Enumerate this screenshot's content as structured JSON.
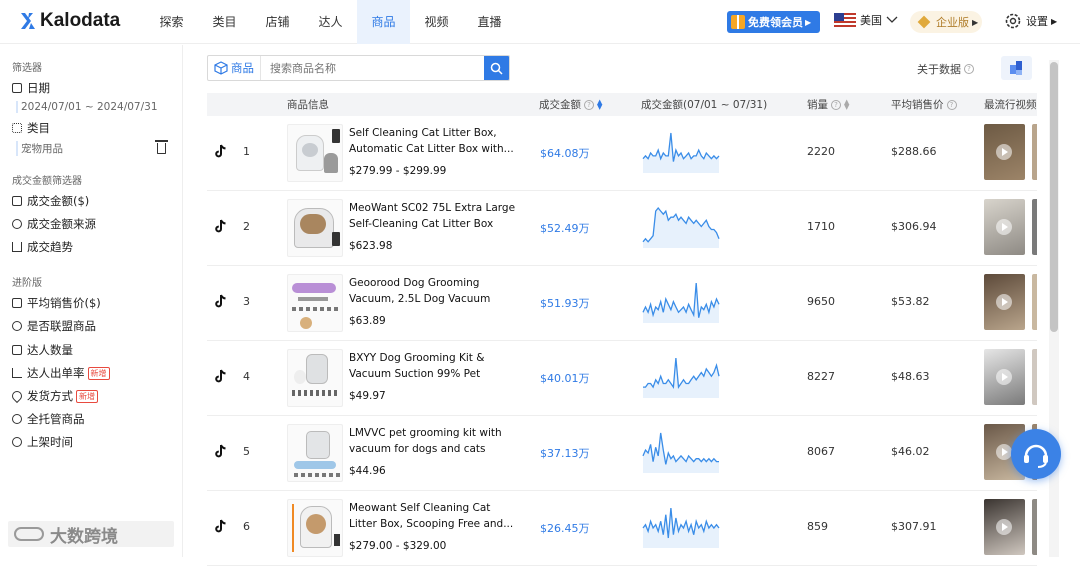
{
  "app": {
    "name": "Kalodata"
  },
  "nav": [
    "探索",
    "类目",
    "店铺",
    "达人",
    "商品",
    "视频",
    "直播"
  ],
  "nav_active_index": 4,
  "header": {
    "promo_label": "免费领会员",
    "region_label": "美国",
    "enterprise_label": "企业版",
    "settings_label": "设置"
  },
  "sidebar": {
    "filter_heading": "筛选器",
    "date_label": "日期",
    "date_value": "2024/07/01 ~ 2024/07/31",
    "category_label": "类目",
    "category_value": "宠物用品",
    "gmv_heading": "成交金额筛选器",
    "gmv_items": [
      "成交金额($)",
      "成交金额来源",
      "成交趋势"
    ],
    "advanced_heading": "进阶版",
    "advanced_items": [
      {
        "label": "平均销售价($)",
        "badge": ""
      },
      {
        "label": "是否联盟商品",
        "badge": ""
      },
      {
        "label": "达人数量",
        "badge": ""
      },
      {
        "label": "达人出单率",
        "badge": "新增"
      },
      {
        "label": "发货方式",
        "badge": "新增"
      },
      {
        "label": "全托管商品",
        "badge": ""
      },
      {
        "label": "上架时间",
        "badge": ""
      }
    ],
    "watermark": "大数跨境"
  },
  "search": {
    "tag_label": "商品",
    "placeholder": "搜索商品名称"
  },
  "about_data_label": "关于数据",
  "table": {
    "columns": [
      "商品信息",
      "成交金额",
      "成交金额(07/01 ~ 07/31)",
      "销量",
      "平均销售价",
      "最流行视频"
    ],
    "rows": [
      {
        "rank": "1",
        "title": "Self Cleaning Cat Litter Box, Automatic Cat Litter Box with...",
        "price": "$279.99 - $299.99",
        "gmv": "$64.08万",
        "sales": "2220",
        "avg_price": "$288.66",
        "trend": [
          5,
          6,
          5,
          7,
          6,
          6,
          8,
          5,
          7,
          6,
          6,
          14,
          4,
          8,
          6,
          7,
          5,
          6,
          7,
          5,
          6,
          6,
          8,
          6,
          5,
          7,
          6,
          5,
          6,
          5,
          6
        ]
      },
      {
        "rank": "2",
        "title": "MeoWant SC02 75L Extra Large Self-Cleaning Cat Litter Box wit...",
        "price": "$623.98",
        "gmv": "$52.49万",
        "sales": "1710",
        "avg_price": "$306.94",
        "trend": [
          2,
          3,
          2,
          3,
          4,
          12,
          13,
          12,
          11,
          12,
          9,
          10,
          10,
          11,
          9,
          10,
          9,
          8,
          10,
          9,
          8,
          9,
          8,
          7,
          8,
          9,
          7,
          6,
          6,
          5,
          3
        ]
      },
      {
        "rank": "3",
        "title": "Geoorood Dog Grooming Vacuum, 2.5L Dog Vacuum Brus...",
        "price": "$63.89",
        "gmv": "$51.93万",
        "sales": "9650",
        "avg_price": "$53.82",
        "trend": [
          4,
          6,
          4,
          7,
          3,
          6,
          5,
          8,
          4,
          9,
          7,
          5,
          8,
          6,
          4,
          5,
          6,
          4,
          7,
          5,
          3,
          15,
          2,
          6,
          5,
          7,
          4,
          8,
          6,
          9,
          7
        ]
      },
      {
        "rank": "4",
        "title": "BXYY Dog Grooming Kit & Vacuum Suction 99% Pet Hair,...",
        "price": "$49.97",
        "gmv": "$40.01万",
        "sales": "8227",
        "avg_price": "$48.63",
        "trend": [
          3,
          3,
          4,
          4,
          3,
          5,
          4,
          6,
          4,
          4,
          5,
          4,
          3,
          11,
          3,
          4,
          5,
          4,
          4,
          5,
          6,
          5,
          6,
          7,
          6,
          8,
          7,
          6,
          7,
          9,
          6
        ]
      },
      {
        "rank": "5",
        "title": "LMVVC pet grooming kit with vacuum for dogs and cats",
        "price": "$44.96",
        "gmv": "$37.13万",
        "sales": "8067",
        "avg_price": "$46.02",
        "trend": [
          6,
          8,
          7,
          10,
          4,
          9,
          6,
          14,
          8,
          3,
          7,
          5,
          6,
          4,
          5,
          6,
          5,
          4,
          6,
          5,
          4,
          5,
          5,
          4,
          5,
          4,
          5,
          4,
          5,
          4,
          4
        ]
      },
      {
        "rank": "6",
        "title": "Meowant Self Cleaning Cat Litter Box, Scooping Free and...",
        "price": "$279.00 - $329.00",
        "gmv": "$26.45万",
        "sales": "859",
        "avg_price": "$307.91",
        "trend": [
          6,
          7,
          5,
          8,
          6,
          7,
          5,
          8,
          4,
          10,
          3,
          12,
          4,
          9,
          5,
          7,
          6,
          8,
          5,
          7,
          4,
          8,
          6,
          7,
          5,
          8,
          6,
          7,
          6,
          7,
          6
        ]
      }
    ]
  },
  "colors": {
    "accent": "#2f7ae5",
    "trend_line": "#3a8de8",
    "trend_fill": "#e7f1fc",
    "new_badge": "#e84a3f",
    "enterprise": "#b07d2a"
  }
}
